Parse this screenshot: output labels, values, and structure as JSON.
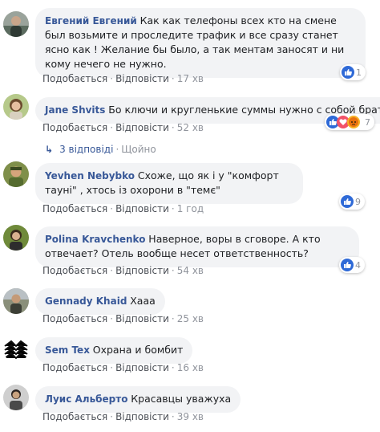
{
  "comments": [
    {
      "author": "Евгений Евгений",
      "text": "Как как телефоны всех кто на смене был возьмите и проследите трафик и все сразу станет ясно как ! Желание бы было, а так ментам заносят и ни кому нечего не нужно.",
      "like_label": "Подобається",
      "reply_label": "Відповісти",
      "time": "17 хв",
      "reaction_count": "1",
      "reaction_types": [
        "like"
      ]
    },
    {
      "author": "Jane Shvits",
      "text": "Бо ключи и кругленькие суммы нужно с собой брать",
      "like_label": "Подобається",
      "reply_label": "Відповісти",
      "time": "52 хв",
      "reaction_count": "7",
      "reaction_types": [
        "like",
        "love",
        "angry"
      ]
    },
    {
      "author": "Yevhen Nebybko",
      "text": "Схоже, що як і у \"комфорт тауні\" , хтось із охорони в \"темє\"",
      "like_label": "Подобається",
      "reply_label": "Відповісти",
      "time": "1 год",
      "reaction_count": "9",
      "reaction_types": [
        "like"
      ]
    },
    {
      "author": "Polina Kravchenko",
      "text": "Наверное, воры в сговоре. А кто отвечает? Отель вообще несет ответственность?",
      "like_label": "Подобається",
      "reply_label": "Відповісти",
      "time": "54 хв",
      "reaction_count": "4",
      "reaction_types": [
        "like"
      ]
    },
    {
      "author": "Gennady Khaid",
      "text": "Хааа",
      "like_label": "Подобається",
      "reply_label": "Відповісти",
      "time": "25 хв"
    },
    {
      "author": "Sem Tex",
      "text": "Охрана и бомбит",
      "like_label": "Подобається",
      "reply_label": "Відповісти",
      "time": "16 хв"
    },
    {
      "author": "Луис Альберто",
      "text": "Красавцы уважуха",
      "like_label": "Подобається",
      "reply_label": "Відповісти",
      "time": "39 хв"
    }
  ],
  "replies_thread": {
    "label": "3 відповіді",
    "separator": "·",
    "status": "Щойно"
  },
  "colors": {
    "author": "#385898",
    "bubble": "#f2f3f5",
    "meta": "#90949c",
    "like": "#2f6ad7"
  }
}
